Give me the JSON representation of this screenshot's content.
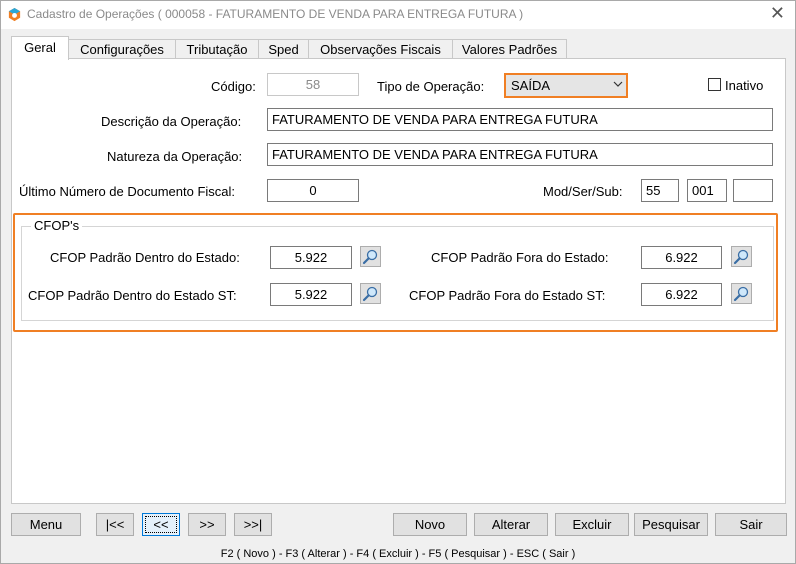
{
  "window": {
    "title": "Cadastro de Operações ( 000058 - FATURAMENTO DE VENDA PARA ENTREGA FUTURA )",
    "close": "✕"
  },
  "tabs": [
    {
      "label": "Geral",
      "active": true
    },
    {
      "label": "Configurações",
      "active": false
    },
    {
      "label": "Tributação",
      "active": false
    },
    {
      "label": "Sped",
      "active": false
    },
    {
      "label": "Observações Fiscais",
      "active": false
    },
    {
      "label": "Valores Padrões",
      "active": false
    }
  ],
  "form": {
    "codigo_label": "Código:",
    "codigo_value": "58",
    "tipo_label": "Tipo de Operação:",
    "tipo_value": "SAÍDA",
    "inativo_label": "Inativo",
    "inativo_checked": false,
    "descricao_label": "Descrição da Operação:",
    "descricao_value": "FATURAMENTO DE VENDA PARA ENTREGA FUTURA",
    "natureza_label": "Natureza da Operação:",
    "natureza_value": "FATURAMENTO DE VENDA PARA ENTREGA FUTURA",
    "ultimo_label": "Último Número de Documento Fiscal:",
    "ultimo_value": "0",
    "modsersub_label": "Mod/Ser/Sub:",
    "mod_value": "55",
    "ser_value": "001",
    "sub_value": ""
  },
  "cfop": {
    "group_title": "CFOP's",
    "dentro_label": "CFOP Padrão Dentro do Estado:",
    "dentro_value": "5.922",
    "fora_label": "CFOP Padrão Fora do Estado:",
    "fora_value": "6.922",
    "dentro_st_label": "CFOP Padrão Dentro do Estado ST:",
    "dentro_st_value": "5.922",
    "fora_st_label": "CFOP Padrão Fora do Estado ST:",
    "fora_st_value": "6.922"
  },
  "buttons": {
    "menu": "Menu",
    "first": "|<<",
    "prev": "<<",
    "next": ">>",
    "last": ">>|",
    "novo": "Novo",
    "alterar": "Alterar",
    "excluir": "Excluir",
    "pesquisar": "Pesquisar",
    "sair": "Sair"
  },
  "statusbar": "F2 ( Novo )  -  F3 ( Alterar )  -  F4 ( Excluir )  -  F5 ( Pesquisar )  -  ESC ( Sair )",
  "colors": {
    "highlight": "#f07f24",
    "focus": "#0078d7"
  },
  "icons": {
    "app": "app-icon",
    "search": "magnifier-icon",
    "dropdown": "chevron-down-icon"
  }
}
